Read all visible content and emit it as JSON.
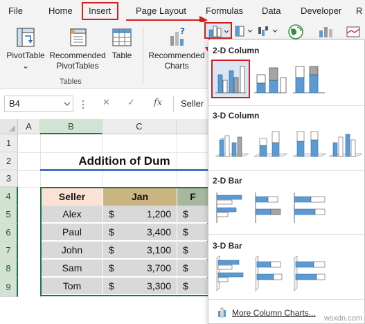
{
  "menu": {
    "file": "File",
    "home": "Home",
    "insert": "Insert",
    "page_layout": "Page Layout",
    "formulas": "Formulas",
    "data": "Data",
    "developer": "Developer",
    "overflow": "R"
  },
  "ribbon": {
    "pivot_table": "PivotTable",
    "recommended_pivot_tables": [
      "Recommended",
      "PivotTables"
    ],
    "table": "Table",
    "tables_group": "Tables",
    "recommended_charts": [
      "Recommended",
      "Charts"
    ],
    "dropdown_chevron": "⌄"
  },
  "formula_bar": {
    "name_box": "B4",
    "cancel": "✕",
    "enter": "✓",
    "fx": "fx",
    "content": "Seller"
  },
  "grid": {
    "columns": [
      "A",
      "B",
      "C"
    ],
    "rows": [
      "1",
      "2",
      "3",
      "4",
      "5",
      "6",
      "7",
      "8",
      "9"
    ],
    "title": "Addition of Dum",
    "headers": {
      "seller": "Seller",
      "jan": "Jan",
      "feb": "F"
    },
    "currency": "$",
    "data": [
      {
        "seller": "Alex",
        "jan": "1,200",
        "feb_cur": "$"
      },
      {
        "seller": "Paul",
        "jan": "3,400",
        "feb_cur": "$"
      },
      {
        "seller": "John",
        "jan": "3,100",
        "feb_cur": "$"
      },
      {
        "seller": "Sam",
        "jan": "3,700",
        "feb_cur": "$"
      },
      {
        "seller": "Tom",
        "jan": "3,300",
        "feb_cur": "$"
      }
    ]
  },
  "dropdown": {
    "section_2d_column": "2-D Column",
    "section_3d_column": "3-D Column",
    "section_2d_bar": "2-D Bar",
    "section_3d_bar": "3-D Bar",
    "more": "More Column Charts..."
  },
  "watermark": "wsxdn.com",
  "colors": {
    "accent_red": "#d21e1e",
    "excel_green": "#217346",
    "chart_blue": "#5b9bd5",
    "chart_gray": "#a5a5a5",
    "title_underline": "#4472c4"
  }
}
